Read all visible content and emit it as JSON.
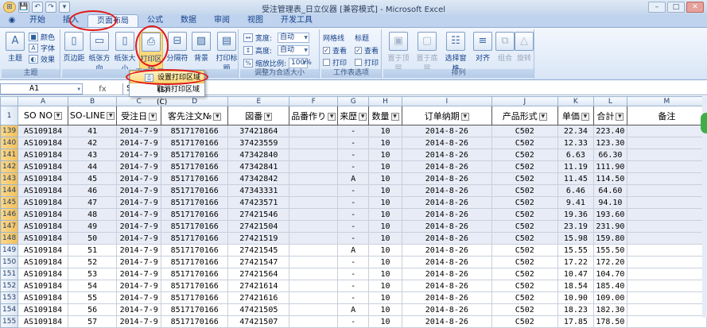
{
  "window": {
    "title": "受注管理表_日立仪器 [兼容模式] - Microsoft Excel"
  },
  "qat": [
    "💾",
    "↶",
    "↷",
    "▾"
  ],
  "tabs": [
    "开始",
    "插入",
    "页面布局",
    "公式",
    "数据",
    "审阅",
    "视图",
    "开发工具"
  ],
  "active_tab": "页面布局",
  "ribbon": {
    "themes": {
      "big": "主题",
      "colors": "颜色",
      "fonts": "字体",
      "effects": "效果",
      "group": "主题"
    },
    "page_setup": {
      "margins": "页边距",
      "orientation": "纸张方向",
      "size": "纸张大小",
      "print_area": "打印区域",
      "breaks": "分隔符",
      "background": "背景",
      "print_titles": "打印标题",
      "group": "页面设置"
    },
    "scale": {
      "width_label": "宽度:",
      "width_value": "自动",
      "height_label": "高度:",
      "height_value": "自动",
      "scale_label": "缩放比例:",
      "scale_value": "100%",
      "group": "调整为合适大小"
    },
    "sheet_options": {
      "gridlines": "网格线",
      "headings": "标题",
      "view1": "查看",
      "view2": "查看",
      "print1": "打印",
      "print2": "打印",
      "group": "工作表选项"
    },
    "arrange": {
      "bring_front": "置于顶层",
      "send_back": "置于底层",
      "selection_pane": "选择窗格",
      "align": "对齐",
      "group_btn": "组合",
      "rotate": "旋转",
      "group": "排列"
    }
  },
  "dropdown": {
    "items": [
      "设置打印区域(S)",
      "取消打印区域(C)"
    ]
  },
  "formula_bar": {
    "name_box": "A1",
    "fx": "fx",
    "content": "SO"
  },
  "columns": [
    "A",
    "B",
    "C",
    "D",
    "E",
    "F",
    "G",
    "H",
    "I",
    "J",
    "K",
    "L",
    "M"
  ],
  "header_row": {
    "row": "1",
    "cells": [
      "SO NO",
      "SO-LINE",
      "受注日",
      "客先注文№",
      "図番",
      "品番作り",
      "来歴",
      "数量",
      "订单纳期",
      "产品形式",
      "单価",
      "合計",
      "备注"
    ]
  },
  "rows": [
    {
      "row": "139",
      "cells": [
        "AS109184",
        "41",
        "2014-7-9",
        "8517170166",
        "37421864",
        "",
        "-",
        "10",
        "2014-8-26",
        "C502",
        "22.34",
        "223.40",
        ""
      ]
    },
    {
      "row": "140",
      "cells": [
        "AS109184",
        "42",
        "2014-7-9",
        "8517170166",
        "37423559",
        "",
        "-",
        "10",
        "2014-8-26",
        "C502",
        "12.33",
        "123.30",
        ""
      ]
    },
    {
      "row": "141",
      "cells": [
        "AS109184",
        "43",
        "2014-7-9",
        "8517170166",
        "47342840",
        "",
        "-",
        "10",
        "2014-8-26",
        "C502",
        "6.63",
        "66.30",
        ""
      ]
    },
    {
      "row": "142",
      "cells": [
        "AS109184",
        "44",
        "2014-7-9",
        "8517170166",
        "47342841",
        "",
        "-",
        "10",
        "2014-8-26",
        "C502",
        "11.19",
        "111.90",
        ""
      ]
    },
    {
      "row": "143",
      "cells": [
        "AS109184",
        "45",
        "2014-7-9",
        "8517170166",
        "47342842",
        "",
        "A",
        "10",
        "2014-8-26",
        "C502",
        "11.45",
        "114.50",
        ""
      ]
    },
    {
      "row": "144",
      "cells": [
        "AS109184",
        "46",
        "2014-7-9",
        "8517170166",
        "47343331",
        "",
        "-",
        "10",
        "2014-8-26",
        "C502",
        "6.46",
        "64.60",
        ""
      ]
    },
    {
      "row": "145",
      "cells": [
        "AS109184",
        "47",
        "2014-7-9",
        "8517170166",
        "47423571",
        "",
        "-",
        "10",
        "2014-8-26",
        "C502",
        "9.41",
        "94.10",
        ""
      ]
    },
    {
      "row": "146",
      "cells": [
        "AS109184",
        "48",
        "2014-7-9",
        "8517170166",
        "27421546",
        "",
        "-",
        "10",
        "2014-8-26",
        "C502",
        "19.36",
        "193.60",
        ""
      ]
    },
    {
      "row": "147",
      "cells": [
        "AS109184",
        "49",
        "2014-7-9",
        "8517170166",
        "27421504",
        "",
        "-",
        "10",
        "2014-8-26",
        "C502",
        "23.19",
        "231.90",
        ""
      ]
    },
    {
      "row": "148",
      "cells": [
        "AS109184",
        "50",
        "2014-7-9",
        "8517170166",
        "27421519",
        "",
        "-",
        "10",
        "2014-8-26",
        "C502",
        "15.98",
        "159.80",
        ""
      ]
    },
    {
      "row": "149",
      "cells": [
        "AS109184",
        "51",
        "2014-7-9",
        "8517170166",
        "27421545",
        "",
        "A",
        "10",
        "2014-8-26",
        "C502",
        "15.55",
        "155.50",
        ""
      ]
    },
    {
      "row": "150",
      "cells": [
        "AS109184",
        "52",
        "2014-7-9",
        "8517170166",
        "27421547",
        "",
        "-",
        "10",
        "2014-8-26",
        "C502",
        "17.22",
        "172.20",
        ""
      ]
    },
    {
      "row": "151",
      "cells": [
        "AS109184",
        "53",
        "2014-7-9",
        "8517170166",
        "27421564",
        "",
        "-",
        "10",
        "2014-8-26",
        "C502",
        "10.47",
        "104.70",
        ""
      ]
    },
    {
      "row": "152",
      "cells": [
        "AS109184",
        "54",
        "2014-7-9",
        "8517170166",
        "27421614",
        "",
        "-",
        "10",
        "2014-8-26",
        "C502",
        "18.54",
        "185.40",
        ""
      ]
    },
    {
      "row": "153",
      "cells": [
        "AS109184",
        "55",
        "2014-7-9",
        "8517170166",
        "27421616",
        "",
        "-",
        "10",
        "2014-8-26",
        "C502",
        "10.90",
        "109.00",
        ""
      ]
    },
    {
      "row": "154",
      "cells": [
        "AS109184",
        "56",
        "2014-7-9",
        "8517170166",
        "47421505",
        "",
        "A",
        "10",
        "2014-8-26",
        "C502",
        "18.23",
        "182.30",
        ""
      ]
    },
    {
      "row": "155",
      "cells": [
        "AS109184",
        "57",
        "2014-7-9",
        "8517170166",
        "47421507",
        "",
        "-",
        "10",
        "2014-8-26",
        "C502",
        "17.85",
        "178.50",
        ""
      ]
    }
  ]
}
